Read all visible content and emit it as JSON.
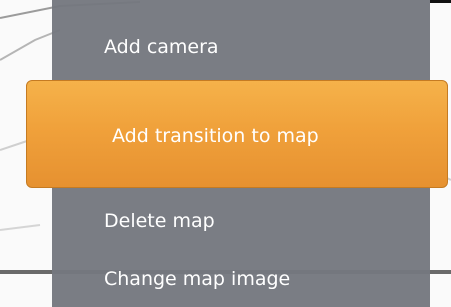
{
  "context_menu": {
    "items": [
      {
        "label": "Add camera"
      },
      {
        "label": "Add transition to map",
        "highlighted": true
      },
      {
        "label": "Delete map"
      },
      {
        "label": "Change map image"
      }
    ]
  },
  "colors": {
    "menu_background": "#75787f",
    "highlight_top": "#f5b24a",
    "highlight_bottom": "#e69130",
    "text": "#ffffff"
  }
}
